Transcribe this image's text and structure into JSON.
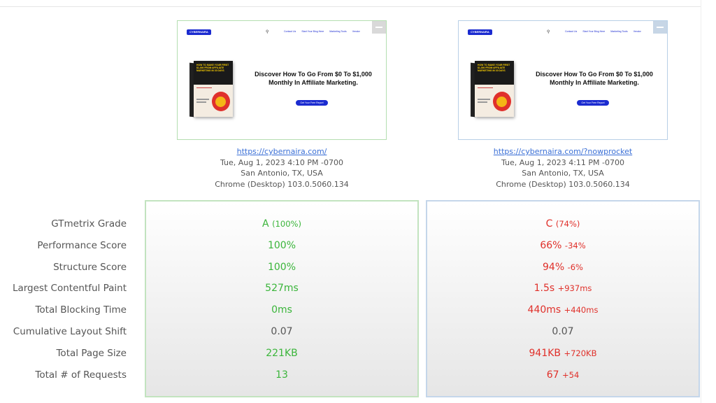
{
  "reports": [
    {
      "url": "https://cybernaira.com/",
      "datetime": "Tue, Aug 1, 2023 4:10 PM -0700",
      "location": "San Antonio, TX, USA",
      "browser": "Chrome (Desktop) 103.0.5060.134"
    },
    {
      "url": "https://cybernaira.com/?nowprocket",
      "datetime": "Tue, Aug 1, 2023 4:11 PM -0700",
      "location": "San Antonio, TX, USA",
      "browser": "Chrome (Desktop) 103.0.5060.134"
    }
  ],
  "thumbnail": {
    "logo": "CYBERNAIRA",
    "nav": [
      "Contact Us",
      "Start Your Blog Here",
      "Marketing Tools",
      "Vendor"
    ],
    "book_title": "HOW TO MAKE YOUR FIRST $1,000 FROM AFFILIATE MARKETING IN 30 DAYS",
    "headline": "Discover How To Go From $0 To $1,000 Monthly In Affiliate Marketing.",
    "cta": "Get Your Free Report"
  },
  "metrics": {
    "labels": [
      "GTmetrix Grade",
      "Performance Score",
      "Structure Score",
      "Largest Contentful Paint",
      "Total Blocking Time",
      "Cumulative Layout Shift",
      "Total Page Size",
      "Total # of Requests"
    ],
    "left": {
      "grade": "A",
      "grade_pct": "(100%)",
      "performance": "100%",
      "structure": "100%",
      "lcp": "527ms",
      "tbt": "0ms",
      "cls": "0.07",
      "page_size": "221KB",
      "requests": "13"
    },
    "right": {
      "grade": "C",
      "grade_pct": "(74%)",
      "performance": "66%",
      "performance_diff": "-34%",
      "structure": "94%",
      "structure_diff": "-6%",
      "lcp": "1.5s",
      "lcp_diff": "+937ms",
      "tbt": "440ms",
      "tbt_diff": "+440ms",
      "cls": "0.07",
      "page_size": "941KB",
      "page_size_diff": "+720KB",
      "requests": "67",
      "requests_diff": "+54"
    }
  },
  "colors": {
    "good": "#3ab53a",
    "bad": "#e0302a",
    "neutral": "#555555"
  }
}
